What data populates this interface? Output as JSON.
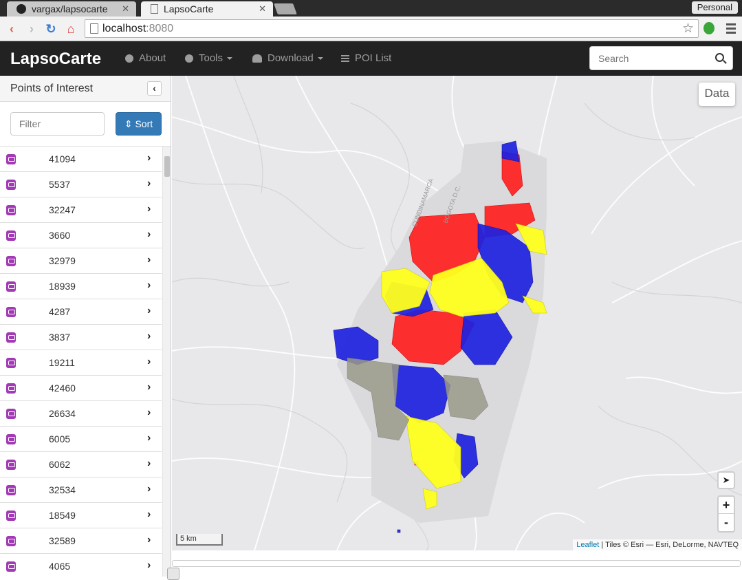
{
  "browser": {
    "tabs": [
      {
        "title": "vargax/lapsocarte",
        "icon": "github-icon"
      },
      {
        "title": "LapsoCarte",
        "icon": "page-icon"
      }
    ],
    "profile": "Personal",
    "address": {
      "host": "localhost",
      "port": ":8080"
    }
  },
  "navbar": {
    "brand": "LapsoCarte",
    "about": "About",
    "tools": "Tools",
    "download": "Download",
    "poi_list": "POI List",
    "search_placeholder": "Search"
  },
  "sidebar": {
    "title": "Points of Interest",
    "filter_placeholder": "Filter",
    "sort_label": "Sort",
    "items": [
      {
        "name": "41094"
      },
      {
        "name": "5537"
      },
      {
        "name": "32247"
      },
      {
        "name": "3660"
      },
      {
        "name": "32979"
      },
      {
        "name": "18939"
      },
      {
        "name": "4287"
      },
      {
        "name": "3837"
      },
      {
        "name": "19211"
      },
      {
        "name": "42460"
      },
      {
        "name": "26634"
      },
      {
        "name": "6005"
      },
      {
        "name": "6062"
      },
      {
        "name": "32534"
      },
      {
        "name": "18549"
      },
      {
        "name": "32589"
      },
      {
        "name": "4065"
      }
    ]
  },
  "map": {
    "data_button": "Data",
    "zoom_in": "+",
    "zoom_out": "-",
    "scale": "5 km",
    "attribution_link": "Leaflet",
    "attribution_text": " | Tiles © Esri — Esri, DeLorme, NAVTEQ",
    "region_labels": [
      "CUNDINAMARCA",
      "BOGOTA D.C."
    ],
    "colors": {
      "red": "#ff2020",
      "blue": "#1e22e0",
      "yellow": "#ffff1e",
      "gray": "#9a9a8a",
      "water": "#e8e7e9"
    }
  }
}
